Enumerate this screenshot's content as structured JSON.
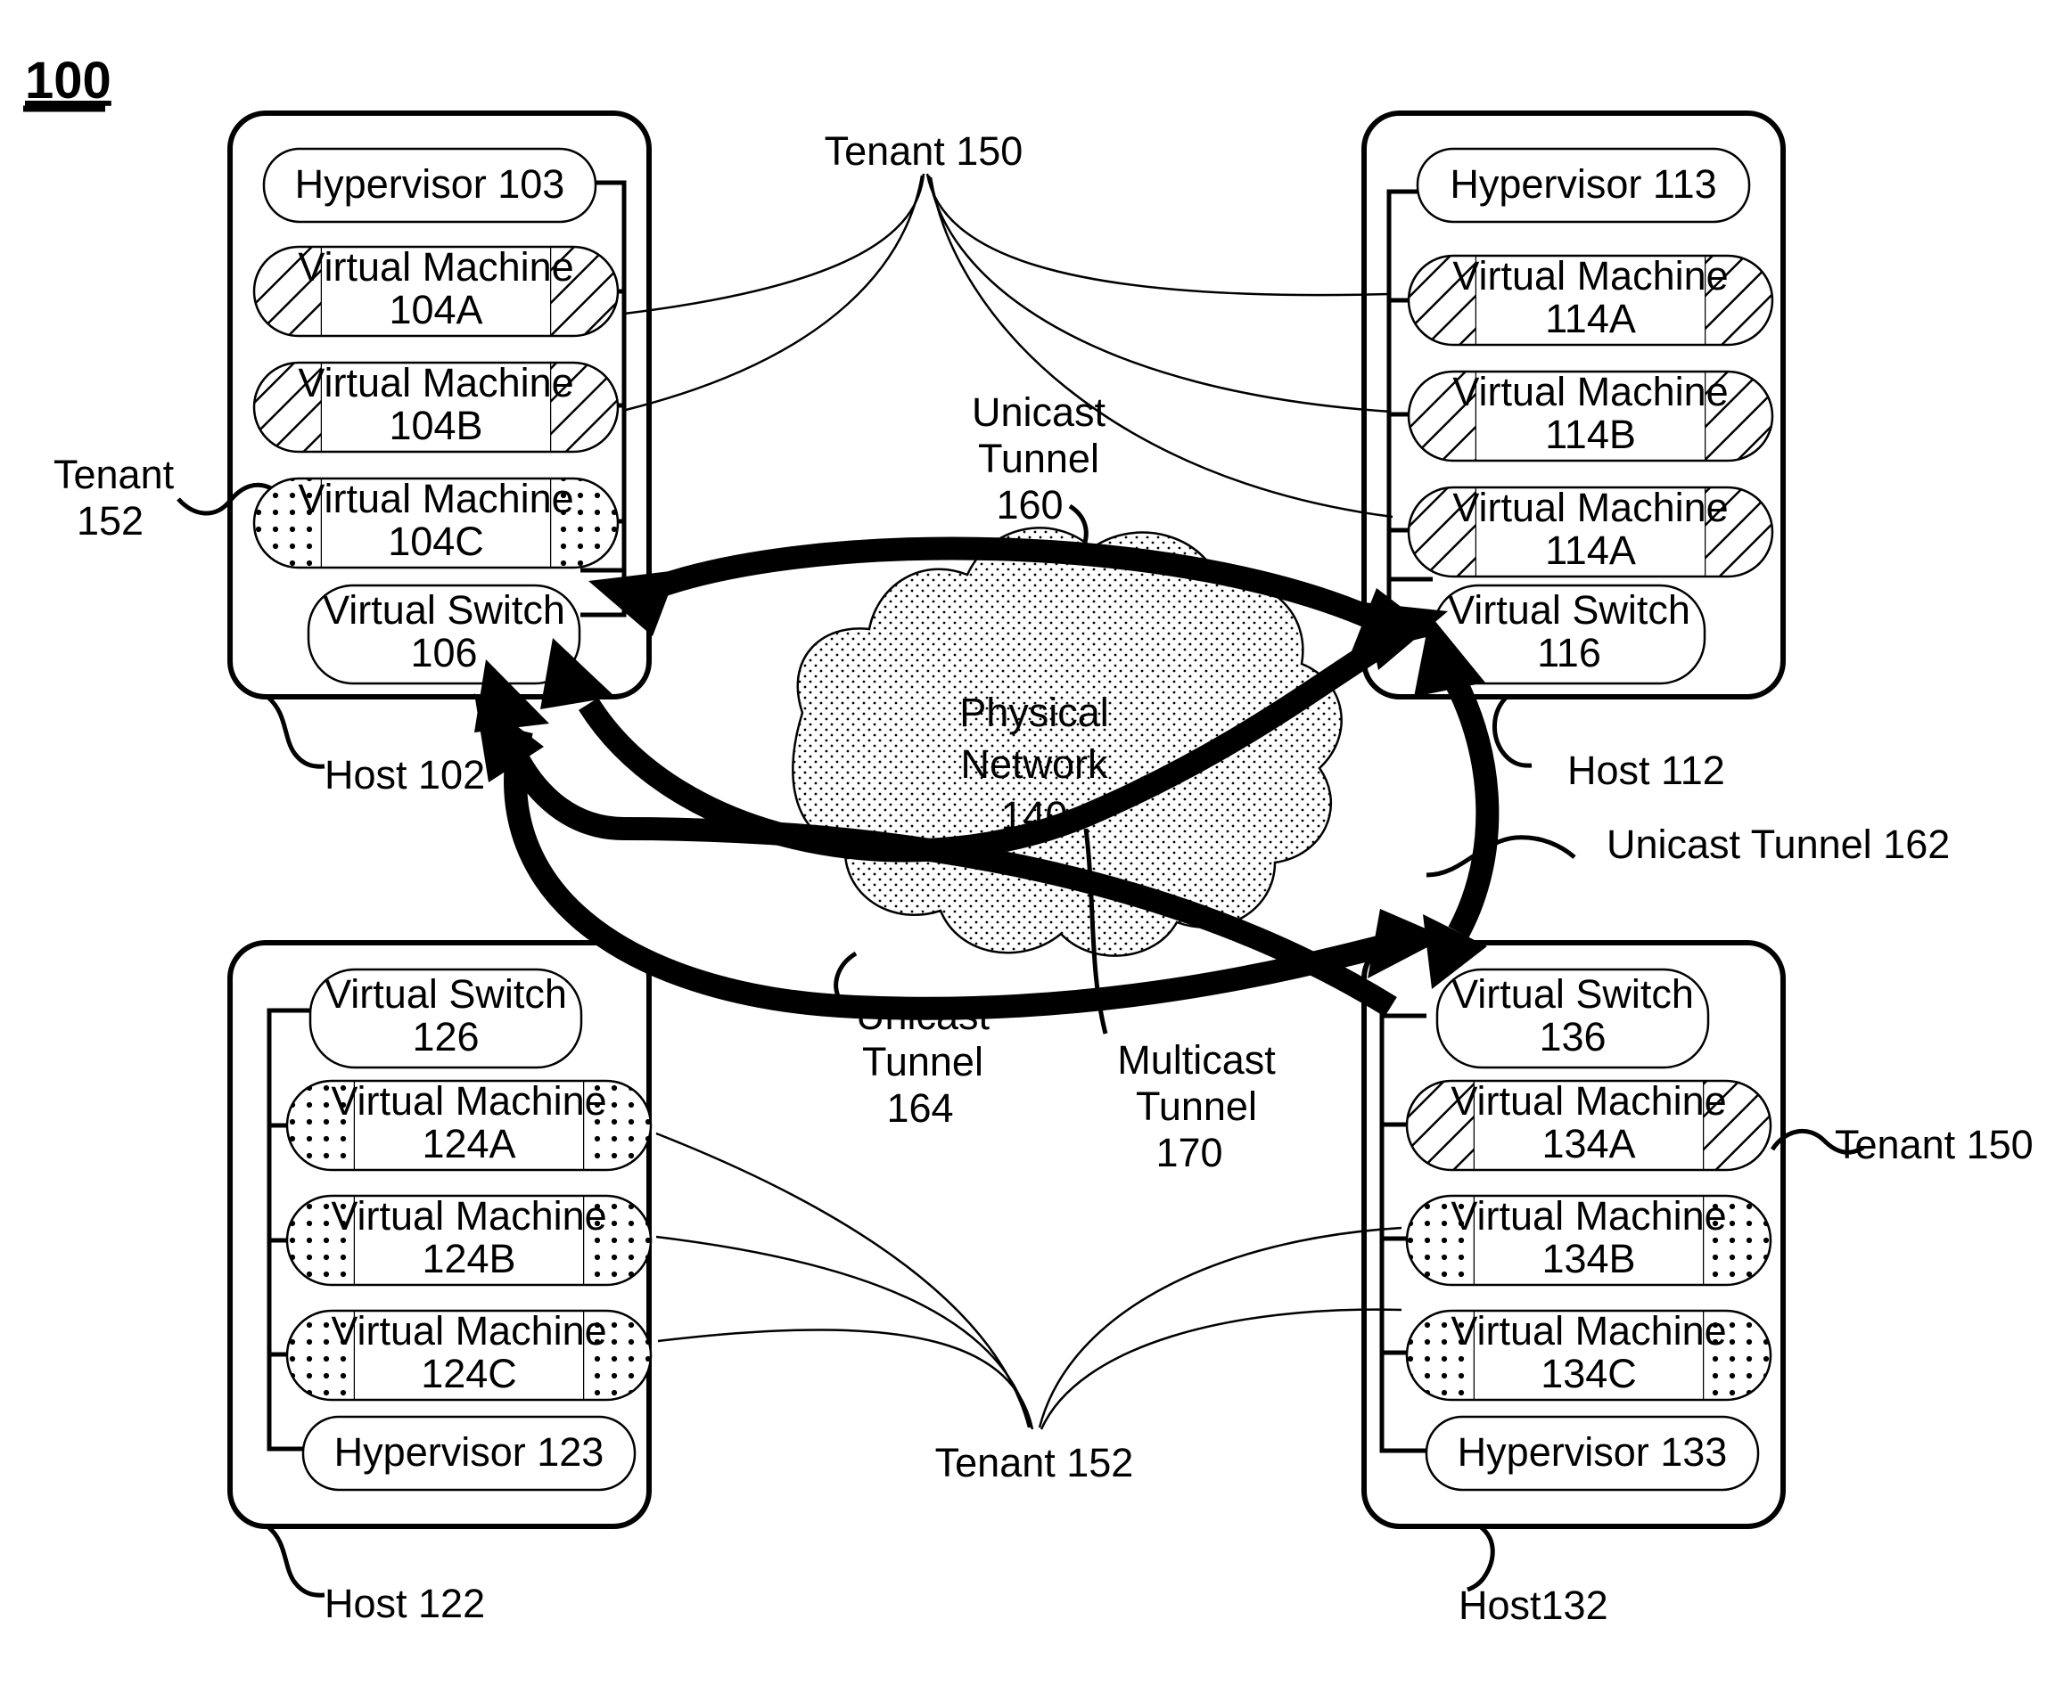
{
  "figure": {
    "number": "100"
  },
  "hosts": [
    {
      "id": "host-102",
      "label": "Host 102",
      "hypervisor": "Hypervisor 103",
      "switch_line1": "Virtual Switch",
      "switch_line2": "106",
      "vms": [
        {
          "line1": "Virtual Machine",
          "line2": "104A",
          "fill": "hatch"
        },
        {
          "line1": "Virtual Machine",
          "line2": "104B",
          "fill": "hatch"
        },
        {
          "line1": "Virtual Machine",
          "line2": "104C",
          "fill": "dots"
        }
      ]
    },
    {
      "id": "host-112",
      "label": "Host 112",
      "hypervisor": "Hypervisor 113",
      "switch_line1": "Virtual Switch",
      "switch_line2": "116",
      "vms": [
        {
          "line1": "Virtual Machine",
          "line2": "114A",
          "fill": "hatch"
        },
        {
          "line1": "Virtual Machine",
          "line2": "114B",
          "fill": "hatch"
        },
        {
          "line1": "Virtual Machine",
          "line2": "114A",
          "fill": "hatch"
        }
      ]
    },
    {
      "id": "host-122",
      "label": "Host 122",
      "hypervisor": "Hypervisor 123",
      "switch_line1": "Virtual Switch",
      "switch_line2": "126",
      "vms": [
        {
          "line1": "Virtual Machine",
          "line2": "124A",
          "fill": "dots"
        },
        {
          "line1": "Virtual Machine",
          "line2": "124B",
          "fill": "dots"
        },
        {
          "line1": "Virtual Machine",
          "line2": "124C",
          "fill": "dots"
        }
      ]
    },
    {
      "id": "host-132",
      "label": "Host132",
      "hypervisor": "Hypervisor 133",
      "switch_line1": "Virtual Switch",
      "switch_line2": "136",
      "vms": [
        {
          "line1": "Virtual Machine",
          "line2": "134A",
          "fill": "hatch"
        },
        {
          "line1": "Virtual Machine",
          "line2": "134B",
          "fill": "dots"
        },
        {
          "line1": "Virtual Machine",
          "line2": "134C",
          "fill": "dots"
        }
      ]
    }
  ],
  "network": {
    "cloud_line1": "Physical",
    "cloud_line2": "Network",
    "cloud_line3": "140"
  },
  "annotations": {
    "tenant_150_top": "Tenant 150",
    "tenant_152_left_l1": "Tenant",
    "tenant_152_left_l2": "152",
    "tenant_152_bottom": "Tenant 152",
    "tenant_150_right": "Tenant 150",
    "unicast_160_l1": "Unicast",
    "unicast_160_l2": "Tunnel",
    "unicast_160_l3": "160",
    "unicast_162": "Unicast Tunnel 162",
    "unicast_164_l1": "Unicast",
    "unicast_164_l2": "Tunnel",
    "unicast_164_l3": "164",
    "multicast_170_l1": "Multicast",
    "multicast_170_l2": "Tunnel",
    "multicast_170_l3": "170"
  },
  "colors": {
    "ink": "#000000",
    "paper": "#ffffff"
  }
}
